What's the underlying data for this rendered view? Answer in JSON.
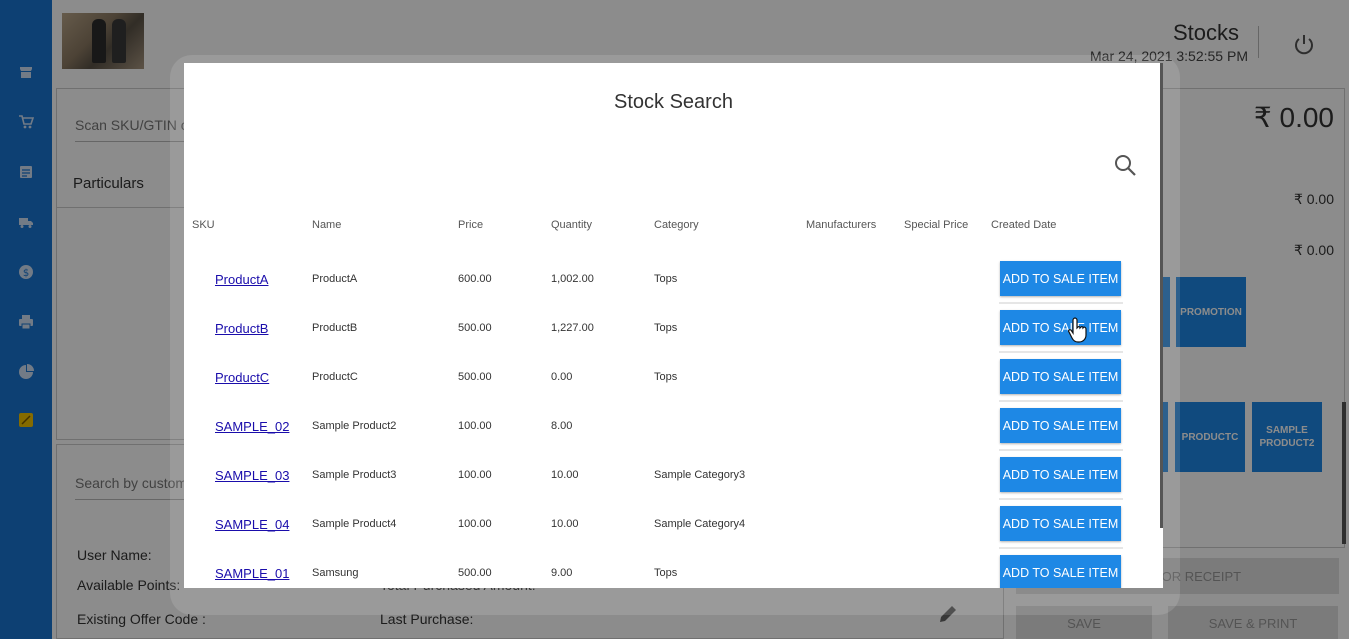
{
  "header": {
    "title": "Stocks",
    "datetime": "Mar 24, 2021 3:52:55 PM"
  },
  "sidebar": {
    "icons": [
      "store-icon",
      "cart-icon",
      "list-icon",
      "truck-icon",
      "dollar-icon",
      "print-icon",
      "pie-chart-icon",
      "tag-icon"
    ]
  },
  "left": {
    "scan_placeholder": "Scan SKU/GTIN o",
    "particulars": "Particulars",
    "customer_placeholder": "Search by custom",
    "user_name_label": "User Name:",
    "available_points_label": "Available Points:",
    "total_purchased_label": "Total Purchased Amount:",
    "existing_offer_label": "Existing Offer Code :",
    "last_purchase_label": "Last Purchase:"
  },
  "right": {
    "total": "₹ 0.00",
    "subtotal1": "₹ 0.00",
    "subtotal2": "₹ 0.00",
    "tiles": {
      "promotion": "PROMOTION",
      "productc": "PRODUCTC",
      "sample_product2": "SAMPLE PRODUCT2"
    },
    "need_receipt": "NEED FOR RECEIPT",
    "save": "SAVE",
    "save_print": "SAVE & PRINT"
  },
  "modal": {
    "title": "Stock Search",
    "columns": [
      "SKU",
      "Name",
      "Price",
      "Quantity",
      "Category",
      "Manufacturers",
      "Special Price",
      "Created Date"
    ],
    "add_label": "ADD TO SALE ITEM",
    "rows": [
      {
        "sku": "ProductA",
        "name": "ProductA",
        "price": "600.00",
        "quantity": "1,002.00",
        "category": "Tops"
      },
      {
        "sku": "ProductB",
        "name": "ProductB",
        "price": "500.00",
        "quantity": "1,227.00",
        "category": "Tops"
      },
      {
        "sku": "ProductC",
        "name": "ProductC",
        "price": "500.00",
        "quantity": "0.00",
        "category": "Tops"
      },
      {
        "sku": "SAMPLE_02",
        "name": "Sample Product2",
        "price": "100.00",
        "quantity": "8.00",
        "category": ""
      },
      {
        "sku": "SAMPLE_03",
        "name": "Sample Product3",
        "price": "100.00",
        "quantity": "10.00",
        "category": "Sample Category3"
      },
      {
        "sku": "SAMPLE_04",
        "name": "Sample Product4",
        "price": "100.00",
        "quantity": "10.00",
        "category": "Sample Category4"
      },
      {
        "sku": "SAMPLE_01",
        "name": "Samsung",
        "price": "500.00",
        "quantity": "9.00",
        "category": "Tops"
      }
    ]
  }
}
